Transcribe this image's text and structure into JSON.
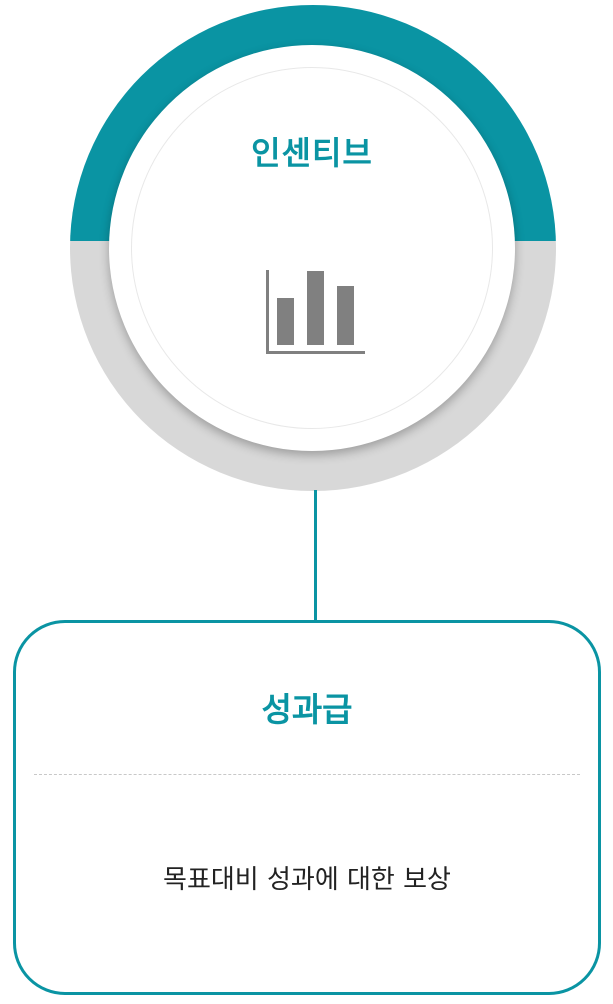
{
  "badge": {
    "title": "인센티브",
    "icon": "bar-chart-icon"
  },
  "card": {
    "title": "성과급",
    "description": "목표대비 성과에 대한 보상"
  },
  "colors": {
    "accent": "#0a94a3",
    "ring_bottom": "#d8d8d8",
    "icon": "#808080",
    "text": "#222222"
  }
}
